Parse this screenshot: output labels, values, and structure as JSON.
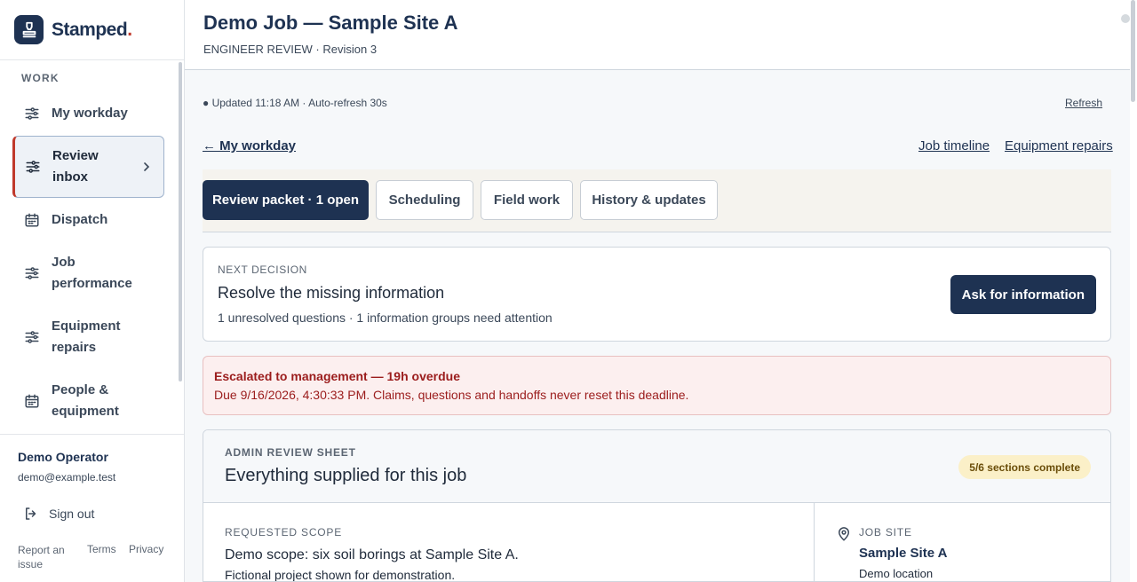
{
  "brand": {
    "name": "Stamped",
    "dot": "."
  },
  "sidebar": {
    "section_heading": "WORK",
    "items": [
      {
        "label": "My workday",
        "icon": "sliders-icon"
      },
      {
        "label": "Review inbox",
        "icon": "sliders-icon",
        "active": true
      },
      {
        "label": "Dispatch",
        "icon": "calendar-icon"
      },
      {
        "label": "Job performance",
        "icon": "sliders-icon"
      },
      {
        "label": "Equipment repairs",
        "icon": "sliders-icon"
      },
      {
        "label": "People & equipment",
        "icon": "calendar-icon"
      }
    ],
    "user": {
      "name": "Demo Operator",
      "email": "demo@example.test"
    },
    "sign_out": "Sign out",
    "footer": {
      "report": "Report an issue",
      "terms": "Terms",
      "privacy": "Privacy"
    }
  },
  "header": {
    "title": "Demo Job — Sample Site A",
    "subtitle": "ENGINEER REVIEW · Revision 3"
  },
  "status": {
    "updated": "● Updated 11:18 AM · Auto-refresh 30s",
    "refresh": "Refresh"
  },
  "links": {
    "back": "← My workday",
    "timeline": "Job timeline",
    "repairs": "Equipment repairs"
  },
  "tabs": [
    {
      "label": "Review packet · 1 open",
      "active": true
    },
    {
      "label": "Scheduling"
    },
    {
      "label": "Field work"
    },
    {
      "label": "History & updates"
    }
  ],
  "next_decision": {
    "label": "NEXT DECISION",
    "title": "Resolve the missing information",
    "summary": "1 unresolved questions · 1 information groups need attention",
    "button": "Ask for information"
  },
  "alert": {
    "title": "Escalated to management — 19h overdue",
    "body": "Due 9/16/2026, 4:30:33 PM. Claims, questions and handoffs never reset this deadline."
  },
  "review_sheet": {
    "label": "ADMIN REVIEW SHEET",
    "title": "Everything supplied for this job",
    "badge": "5/6 sections complete",
    "requested_scope": {
      "label": "REQUESTED SCOPE",
      "title": "Demo scope: six soil borings at Sample Site A.",
      "note": "Fictional project shown for demonstration."
    },
    "job_site": {
      "label": "JOB SITE",
      "name": "Sample Site A",
      "location": "Demo location"
    }
  },
  "colors": {
    "navy": "#1e3252",
    "accent_red": "#c0392b",
    "alert_bg": "#fcefef",
    "alert_text": "#9b1c1c",
    "badge_bg": "#fbf0c8"
  }
}
